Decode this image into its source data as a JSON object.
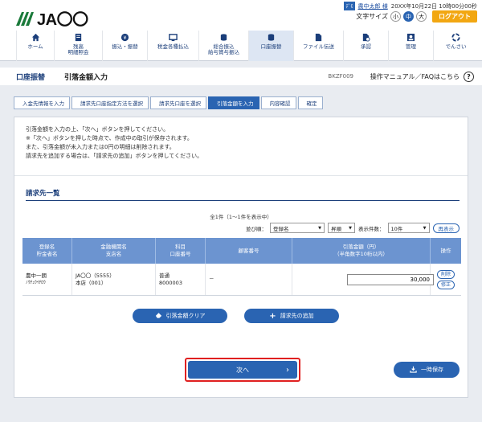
{
  "header": {
    "logo_text": "JA〇〇",
    "user_badge": "ﾃﾞﾓ",
    "user_name": "農中太郎 様",
    "datetime": "20XX年10月22日 10時00分00秒",
    "font_size_label": "文字サイズ",
    "font_sizes": [
      "小",
      "中",
      "大"
    ],
    "logout_label": "ログアウト"
  },
  "nav": {
    "items": [
      {
        "label": "ホーム",
        "icon": "home-icon"
      },
      {
        "label": "残高\n明細照会",
        "icon": "balance-icon"
      },
      {
        "label": "振込・振替",
        "icon": "transfer-icon"
      },
      {
        "label": "税金各種払込",
        "icon": "tax-icon"
      },
      {
        "label": "総合振込\n給与賞与振込",
        "icon": "bulk-transfer-icon"
      },
      {
        "label": "口座振替",
        "icon": "account-debit-icon"
      },
      {
        "label": "ファイル伝送",
        "icon": "file-transfer-icon"
      },
      {
        "label": "承認",
        "icon": "approval-icon"
      },
      {
        "label": "管理",
        "icon": "admin-icon"
      },
      {
        "label": "でんさい",
        "icon": "densai-icon"
      }
    ]
  },
  "titlebar": {
    "section": "口座振替",
    "title": "引落金額入力",
    "code": "BKZF009",
    "manual_link": "操作マニュアル／FAQはこちら",
    "help_icon": "?"
  },
  "steps": [
    "入金先情報を入力",
    "請求先口座指定方法を選択",
    "請求先口座を選択",
    "引落金額を入力",
    "内容確認",
    "確定"
  ],
  "instructions": [
    "引落金額を入力の上、「次へ」ボタンを押してください。",
    "※「次へ」ボタンを押した時点で、作成中の取引が保存されます。",
    "また、引落金額が未入力または0円の明細は削除されます。",
    "請求先を追加する場合は、「請求先の追加」ボタンを押してください。"
  ],
  "list": {
    "title": "請求先一覧",
    "count_text": "全1件（1～1件を表示中）",
    "sort_label": "並び順：",
    "sort_value": "登録名",
    "order_value": "昇順",
    "display_count_label": "表示件数：",
    "display_count_value": "10件",
    "redisplay_label": "再表示",
    "headers": [
      [
        "登録名",
        "貯金者名"
      ],
      [
        "金融機関名",
        "支店名"
      ],
      [
        "科目",
        "口座番号"
      ],
      [
        "顧客番号"
      ],
      [
        "引落金額（円）",
        "（半角数字10桁以内）"
      ],
      [
        "操作"
      ]
    ],
    "rows": [
      {
        "name": "農中一朗",
        "kana": "ﾉｳﾁｭｳｲﾁﾛｳ",
        "bank": "JA〇〇（5555）",
        "branch": "本店（001）",
        "type": "普通",
        "account": "8000003",
        "customer_no": "－",
        "amount": "30,000",
        "delete_label": "削除",
        "edit_label": "修正"
      }
    ]
  },
  "buttons": {
    "clear": "引落金額クリア",
    "add": "請求先の追加",
    "next": "次へ",
    "save": "一時保存"
  },
  "colors": {
    "accent": "#2a64b2",
    "logout": "#f2a712",
    "highlight": "#e02020"
  }
}
